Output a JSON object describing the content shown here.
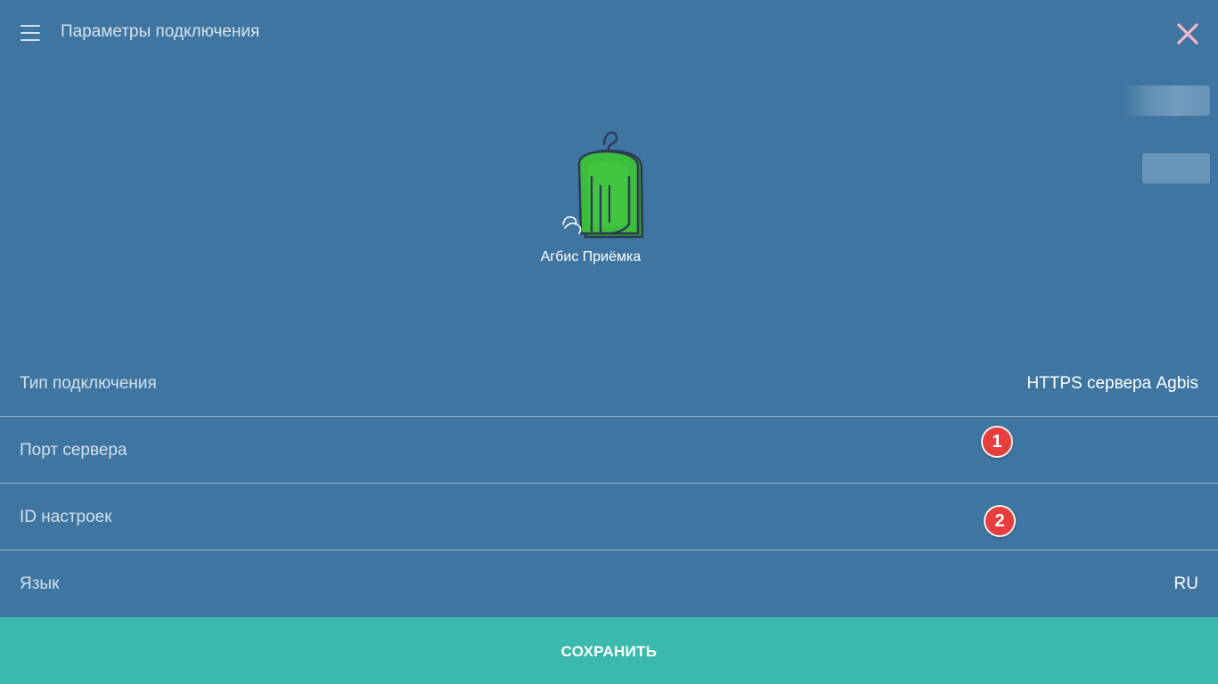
{
  "header": {
    "menu_icon": "hamburger-menu-icon",
    "title": "Параметры подключения",
    "close_icon": "close-icon",
    "close_color": "#f4b8c8"
  },
  "logo": {
    "icon": "coat-on-hanger-logo",
    "app_name": "Агбис Приёмка",
    "colors": {
      "coat": "#3cbe3c",
      "outline": "#2e3a55"
    }
  },
  "settings": {
    "rows": [
      {
        "label": "Тип подключения",
        "value": "HTTPS сервера Agbis"
      },
      {
        "label": "Порт сервера",
        "value": ""
      },
      {
        "label": "ID настроек",
        "value": ""
      },
      {
        "label": "Язык",
        "value": "RU"
      }
    ]
  },
  "annotations": {
    "badge_1": "1",
    "badge_2": "2",
    "badge_color": "#e63d3d"
  },
  "footer": {
    "save_label": "СОХРАНИТЬ",
    "save_color": "#3ab9ac"
  },
  "theme": {
    "background": "#3f76a1"
  }
}
